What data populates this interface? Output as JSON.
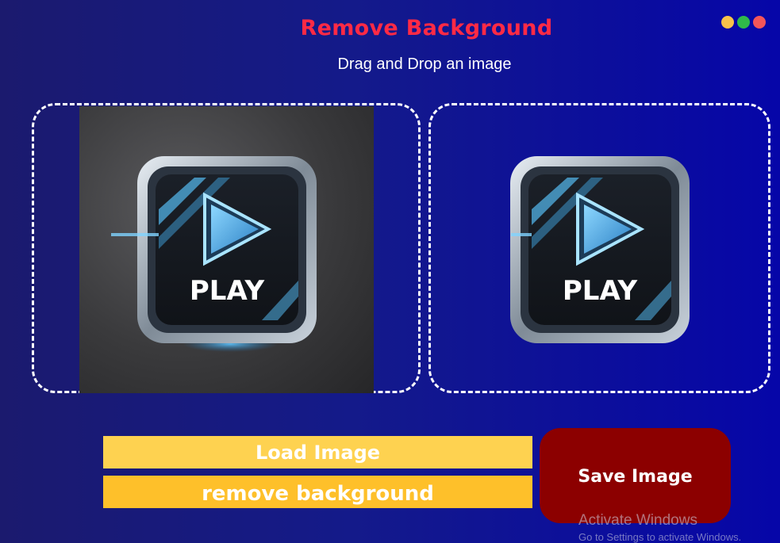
{
  "header": {
    "title": "Remove Background",
    "subtitle": "Drag and Drop an image"
  },
  "window_controls": [
    {
      "name": "minimize",
      "color": "#f7c24a"
    },
    {
      "name": "maximize",
      "color": "#2fb94a"
    },
    {
      "name": "close",
      "color": "#f3555a"
    }
  ],
  "images": {
    "original": {
      "icon": "play-button-icon",
      "label": "PLAY",
      "has_background": true
    },
    "result": {
      "icon": "play-button-icon",
      "label": "PLAY",
      "has_background": false
    }
  },
  "buttons": {
    "load": "Load Image",
    "remove": "remove background",
    "save": "Save Image"
  },
  "watermark": {
    "title": "Activate Windows",
    "subtitle": "Go to Settings to activate Windows."
  },
  "colors": {
    "title": "#ff2a45",
    "load_button": "#fed250",
    "remove_button": "#fec02a",
    "save_button": "#8c0000",
    "background": "#0a0aa8"
  }
}
